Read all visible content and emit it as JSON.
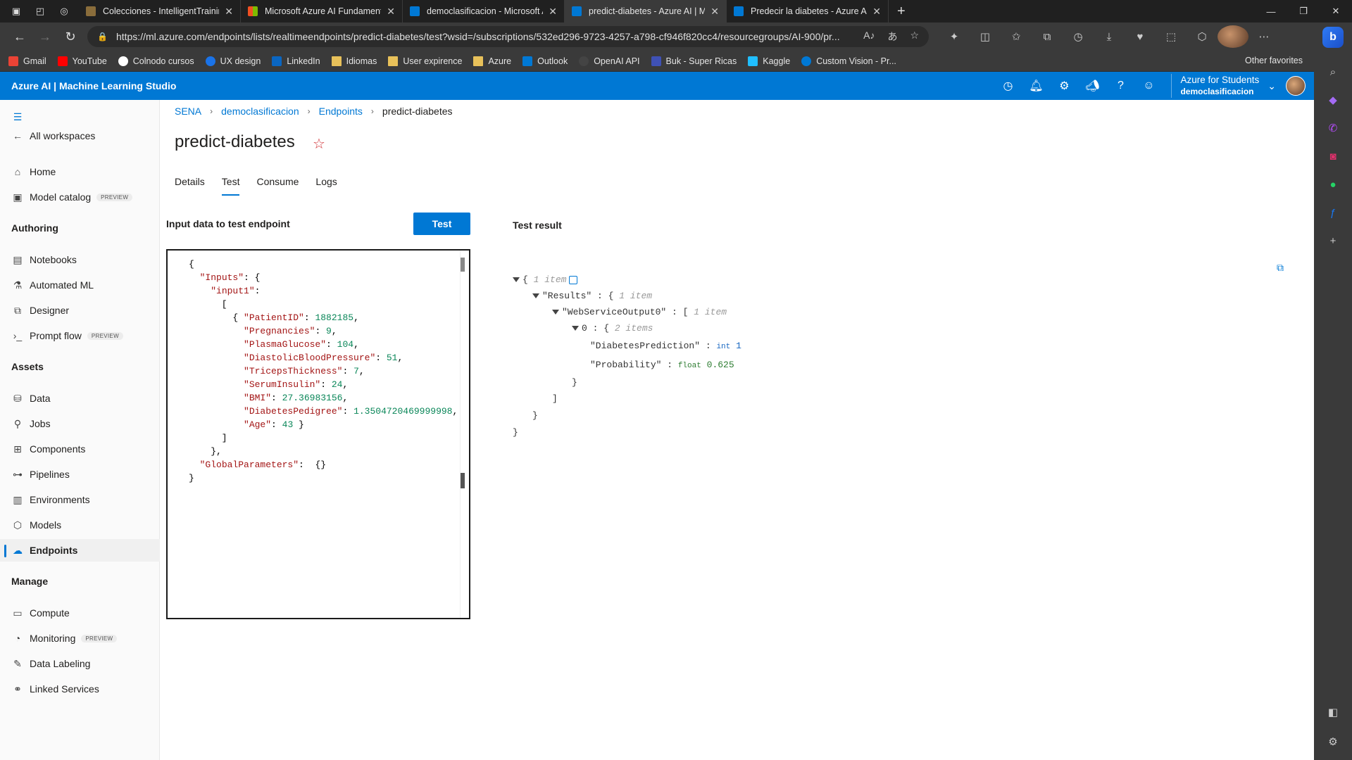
{
  "browser": {
    "tabs": [
      {
        "title": "Colecciones - IntelligentTraining",
        "color": "#8a6d3b"
      },
      {
        "title": "Microsoft Azure AI Fundamentals",
        "color": "#f25022"
      },
      {
        "title": "democlasificacion - Microsoft Az",
        "color": "#0078d4"
      },
      {
        "title": "predict-diabetes - Azure AI | Mac",
        "color": "#0078d4",
        "active": true
      },
      {
        "title": "Predecir la diabetes - Azure AI |",
        "color": "#0078d4"
      }
    ],
    "url": "https://ml.azure.com/endpoints/lists/realtimeendpoints/predict-diabetes/test?wsid=/subscriptions/532ed296-9723-4257-a798-cf946f820cc4/resourcegroups/AI-900/pr...",
    "bookmarks": [
      {
        "label": "Gmail",
        "color": "#ea4335"
      },
      {
        "label": "YouTube",
        "color": "#ff0000"
      },
      {
        "label": "Colnodo cursos",
        "color": "#ffffff"
      },
      {
        "label": "UX design",
        "color": "#1a73e8"
      },
      {
        "label": "LinkedIn",
        "color": "#0a66c2"
      },
      {
        "label": "Idiomas",
        "color": "#e8c15a"
      },
      {
        "label": "User expirence",
        "color": "#e8c15a"
      },
      {
        "label": "Azure",
        "color": "#e8c15a"
      },
      {
        "label": "Outlook",
        "color": "#0078d4"
      },
      {
        "label": "OpenAI API",
        "color": "#444444"
      },
      {
        "label": "Buk - Super Ricas",
        "color": "#3f51b5"
      },
      {
        "label": "Kaggle",
        "color": "#20beff"
      },
      {
        "label": "Custom Vision - Pr...",
        "color": "#0078d4"
      }
    ],
    "other_favorites": "Other favorites"
  },
  "header": {
    "title": "Azure AI | Machine Learning Studio",
    "account_line1": "Azure for Students",
    "account_line2": "democlasificacion"
  },
  "nav": {
    "all_workspaces": "All workspaces",
    "home": "Home",
    "model_catalog": "Model catalog",
    "preview": "PREVIEW",
    "authoring": "Authoring",
    "notebooks": "Notebooks",
    "automated_ml": "Automated ML",
    "designer": "Designer",
    "prompt_flow": "Prompt flow",
    "assets": "Assets",
    "data": "Data",
    "jobs": "Jobs",
    "components": "Components",
    "pipelines": "Pipelines",
    "environments": "Environments",
    "models": "Models",
    "endpoints": "Endpoints",
    "manage": "Manage",
    "compute": "Compute",
    "monitoring": "Monitoring",
    "data_labeling": "Data Labeling",
    "linked_services": "Linked Services"
  },
  "breadcrumb": [
    "SENA",
    "democlasificacion",
    "Endpoints",
    "predict-diabetes"
  ],
  "page": {
    "title": "predict-diabetes",
    "tabs": [
      "Details",
      "Test",
      "Consume",
      "Logs"
    ],
    "input_label": "Input data to test endpoint",
    "test_button": "Test",
    "result_label": "Test result"
  },
  "input": {
    "PatientID": "1882185",
    "Pregnancies": "9",
    "PlasmaGlucose": "104",
    "DiastolicBloodPressure": "51",
    "TricepsThickness": "7",
    "SerumInsulin": "24",
    "BMI": "27.36983156",
    "DiabetesPedigree": "1.3504720469999998",
    "Age": "43"
  },
  "result": {
    "root_meta": "1 item",
    "results_key": "\"Results\"",
    "results_meta": "1 item",
    "output_key": "\"WebServiceOutput0\"",
    "output_meta": "1 item",
    "index_key": "0",
    "index_meta": "2 items",
    "pred_key": "\"DiabetesPrediction\"",
    "pred_type": "int",
    "pred_value": "1",
    "prob_key": "\"Probability\"",
    "prob_type": "float",
    "prob_value": "0.625"
  }
}
